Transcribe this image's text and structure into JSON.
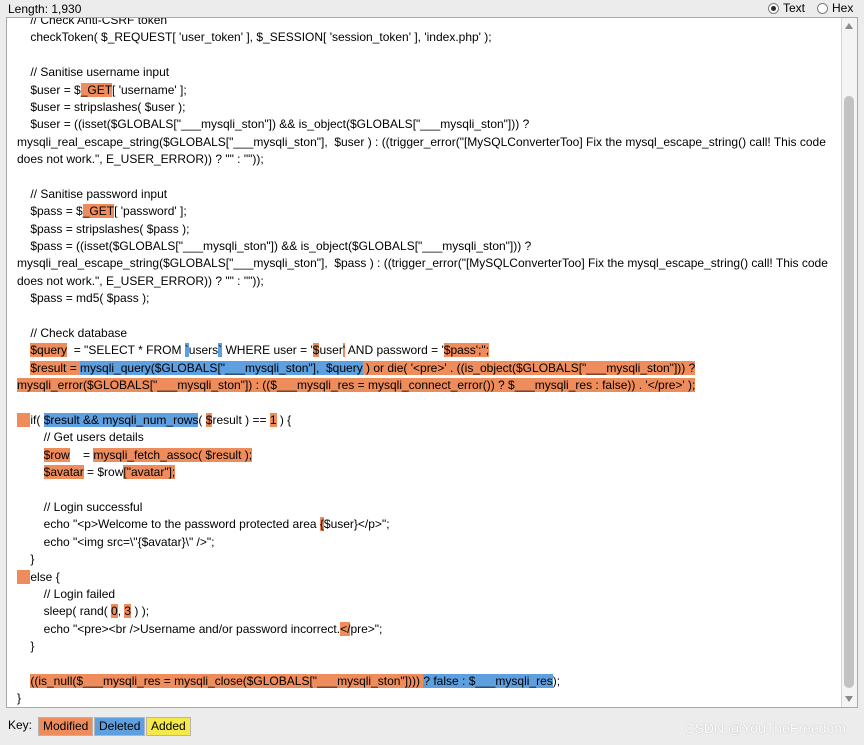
{
  "header": {
    "length_label": "Length: 1,930",
    "text_option": "Text",
    "hex_option": "Hex",
    "selected": "Text"
  },
  "code_lines": [
    [
      {
        "t": "    // Check Anti-CSRF token"
      }
    ],
    [
      {
        "t": "    checkToken( $_REQUEST[ 'user_token' ], $_SESSION[ 'session_token' ], 'index.php' );"
      }
    ],
    [
      {
        "t": ""
      }
    ],
    [
      {
        "t": "    // Sanitise username input"
      }
    ],
    [
      {
        "t": "    $user = $"
      },
      {
        "t": "_GET",
        "h": "mod"
      },
      {
        "t": "[ 'username' ];"
      }
    ],
    [
      {
        "t": "    $user = stripslashes( $user );"
      }
    ],
    [
      {
        "t": "    $user = ((isset($GLOBALS[\"___mysqli_ston\"]) && is_object($GLOBALS[\"___mysqli_ston\"])) ?"
      }
    ],
    [
      {
        "t": "mysqli_real_escape_string($GLOBALS[\"___mysqli_ston\"],  $user ) : ((trigger_error(\"[MySQLConverterToo] Fix the mysql_escape_string() call! This code"
      }
    ],
    [
      {
        "t": "does not work.\", E_USER_ERROR)) ? \"\" : \"\"));"
      }
    ],
    [
      {
        "t": ""
      }
    ],
    [
      {
        "t": "    // Sanitise password input"
      }
    ],
    [
      {
        "t": "    $pass = $"
      },
      {
        "t": "_GET",
        "h": "mod"
      },
      {
        "t": "[ 'password' ];"
      }
    ],
    [
      {
        "t": "    $pass = stripslashes( $pass );"
      }
    ],
    [
      {
        "t": "    $pass = ((isset($GLOBALS[\"___mysqli_ston\"]) && is_object($GLOBALS[\"___mysqli_ston\"])) ?"
      }
    ],
    [
      {
        "t": "mysqli_real_escape_string($GLOBALS[\"___mysqli_ston\"],  $pass ) : ((trigger_error(\"[MySQLConverterToo] Fix the mysql_escape_string() call! This code"
      }
    ],
    [
      {
        "t": "does not work.\", E_USER_ERROR)) ? \"\" : \"\"));"
      }
    ],
    [
      {
        "t": "    $pass = md5( $pass );"
      }
    ],
    [
      {
        "t": ""
      }
    ],
    [
      {
        "t": "    // Check database"
      }
    ],
    [
      {
        "t": "    "
      },
      {
        "t": "$query",
        "h": "mod"
      },
      {
        "t": "  = \"SELECT * FROM "
      },
      {
        "t": "`",
        "h": "del"
      },
      {
        "t": "users"
      },
      {
        "t": "`",
        "h": "del"
      },
      {
        "t": " WHERE user = '"
      },
      {
        "t": "$",
        "h": "mod"
      },
      {
        "t": "user"
      },
      {
        "t": "'",
        "h": "mod"
      },
      {
        "t": " AND password = '"
      },
      {
        "t": "$pass';\";",
        "h": "mod"
      }
    ],
    [
      {
        "t": "    "
      },
      {
        "t": "$result = ",
        "h": "mod"
      },
      {
        "t": "mysqli_query($GLOBALS[\"___mysqli_ston\"],  $query",
        "h": "del"
      },
      {
        "t": " ) or die( '<pre>' . ((is_object($GLOBALS[\"___mysqli_ston\"])) ?",
        "h": "mod"
      }
    ],
    [
      {
        "t": "mysqli_error($GLOBALS[\"___mysqli_ston\"]) : (($___mysqli_res = mysqli_connect_error()) ? $___mysqli_res : false)) . '</pre>' );",
        "h": "mod"
      }
    ],
    [
      {
        "t": ""
      }
    ],
    [
      {
        "t": "    ",
        "h": "mod"
      },
      {
        "t": "if( "
      },
      {
        "t": "$result && mysqli_num_rows",
        "h": "del"
      },
      {
        "t": "( "
      },
      {
        "t": "$",
        "h": "mod"
      },
      {
        "t": "result ) == "
      },
      {
        "t": "1",
        "h": "mod"
      },
      {
        "t": " ) {"
      }
    ],
    [
      {
        "t": "        // Get users details"
      }
    ],
    [
      {
        "t": "        "
      },
      {
        "t": "$row",
        "h": "mod"
      },
      {
        "t": "    = "
      },
      {
        "t": "mysqli_fetch_assoc( $result );",
        "h": "mod"
      }
    ],
    [
      {
        "t": "        "
      },
      {
        "t": "$avatar",
        "h": "mod"
      },
      {
        "t": " = $row"
      },
      {
        "t": "[\"avatar\"];",
        "h": "mod"
      }
    ],
    [
      {
        "t": ""
      }
    ],
    [
      {
        "t": "        // Login successful"
      }
    ],
    [
      {
        "t": "        echo \"<p>Welcome to the password protected area "
      },
      {
        "t": "{",
        "h": "mod"
      },
      {
        "t": "$user}</p>\";"
      }
    ],
    [
      {
        "t": "        echo \"<img src=\\\"{$avatar}\\\" />\";"
      }
    ],
    [
      {
        "t": "    }"
      }
    ],
    [
      {
        "t": "    ",
        "h": "mod"
      },
      {
        "t": "else {"
      }
    ],
    [
      {
        "t": "        // Login failed"
      }
    ],
    [
      {
        "t": "        sleep( rand( "
      },
      {
        "t": "0",
        "h": "mod"
      },
      {
        "t": ", "
      },
      {
        "t": "3",
        "h": "mod"
      },
      {
        "t": " ) );"
      }
    ],
    [
      {
        "t": "        echo \"<pre><br />Username and/or password incorrect."
      },
      {
        "t": "</",
        "h": "mod"
      },
      {
        "t": "pre>\";"
      }
    ],
    [
      {
        "t": "    }"
      }
    ],
    [
      {
        "t": ""
      }
    ],
    [
      {
        "t": "    "
      },
      {
        "t": "((is_null($___mysqli_res = mysqli_close($GLOBALS[\"___mysqli_ston\"]))) ",
        "h": "mod"
      },
      {
        "t": "? false : $___mysqli_res",
        "h": "del"
      },
      {
        "t": ");"
      }
    ],
    [
      {
        "t": "}"
      }
    ]
  ],
  "footer": {
    "key_label": "Key:",
    "modified": "Modified",
    "deleted": "Deleted",
    "added": "Added",
    "watermark": "CSDN @YouTheFreedom"
  },
  "colors": {
    "modified": "#ef8c5c",
    "deleted": "#5e9fe0",
    "added": "#f4e84a"
  }
}
